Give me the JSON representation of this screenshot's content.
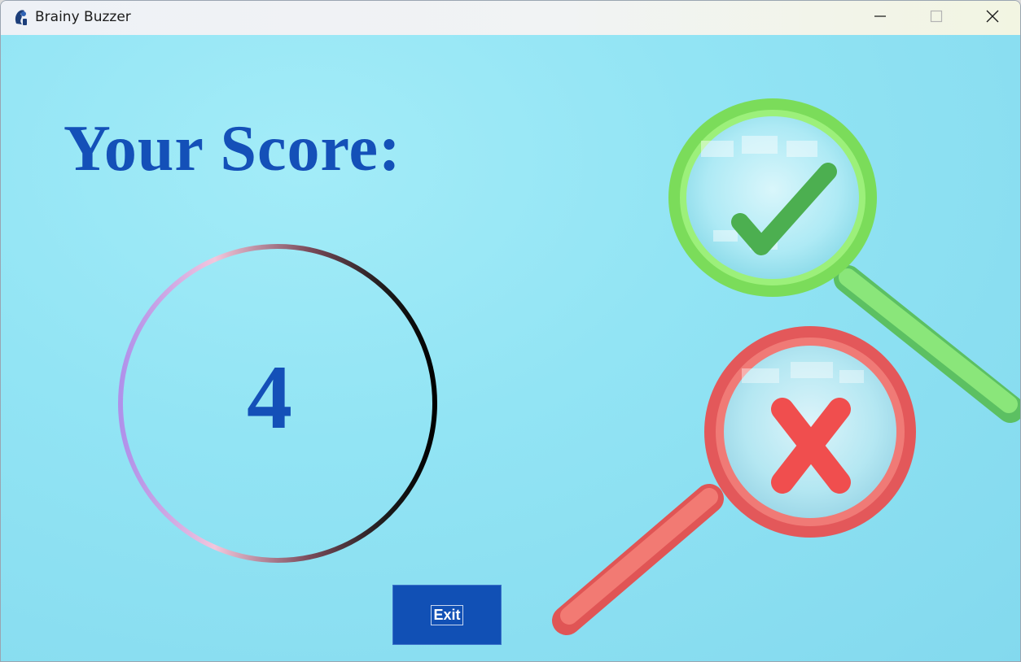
{
  "window": {
    "title": "Brainy Buzzer",
    "app_icon": "brain-buzzer-app-icon",
    "controls": {
      "minimize_icon": "minimize-icon",
      "maximize_icon": "maximize-icon",
      "close_icon": "close-icon"
    }
  },
  "main": {
    "heading": "Your Score:",
    "score": "4",
    "exit_label": "Exit"
  },
  "decor": {
    "correct_icon": "check-mark-icon",
    "wrong_icon": "x-mark-icon"
  },
  "colors": {
    "accent_blue": "#1450b8",
    "button_blue": "#1150b5",
    "background": "#92e4f4",
    "check_green": "#4caf50",
    "cross_red": "#f04e4e"
  }
}
